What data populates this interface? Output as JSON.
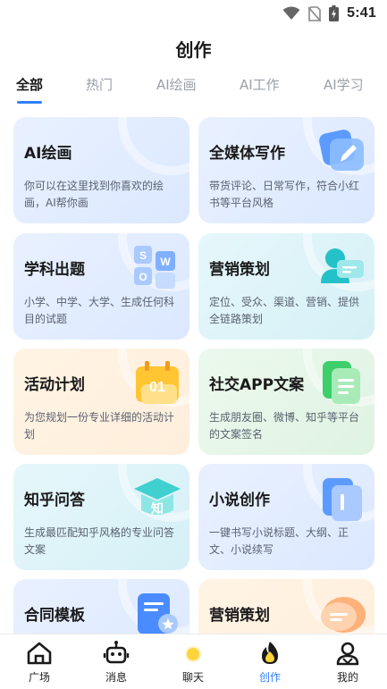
{
  "status_bar": {
    "time": "5:41"
  },
  "header": {
    "title": "创作"
  },
  "tabs": [
    {
      "label": "全部",
      "active": true
    },
    {
      "label": "热门",
      "active": false
    },
    {
      "label": "AI绘画",
      "active": false
    },
    {
      "label": "AI工作",
      "active": false
    },
    {
      "label": "AI学习",
      "active": false
    }
  ],
  "cards": [
    {
      "title": "AI绘画",
      "desc": "你可以在这里找到你喜欢的绘画，AI帮你画",
      "icon": "paint-icon"
    },
    {
      "title": "全媒体写作",
      "desc": "带货评论、日常写作，符合小红书等平台风格",
      "icon": "pencil-edit-icon"
    },
    {
      "title": "学科出题",
      "desc": "小学、中学、大学、生成任何科目的试题",
      "icon": "letter-blocks-icon",
      "icon_letters": [
        "S",
        "W",
        "O"
      ]
    },
    {
      "title": "营销策划",
      "desc": "定位、受众、渠道、营销、提供全链路策划",
      "icon": "person-chat-icon"
    },
    {
      "title": "活动计划",
      "desc": "为您规划一份专业详细的活动计划",
      "icon": "calendar-icon",
      "icon_text": "01"
    },
    {
      "title": "社交APP文案",
      "desc": "生成朋友圈、微博、知乎等平台的文案签名",
      "icon": "document-icon"
    },
    {
      "title": "知乎问答",
      "desc": "生成最匹配知乎风格的专业问答文案",
      "icon": "graduation-cap-icon",
      "icon_text": "知"
    },
    {
      "title": "小说创作",
      "desc": "一键书写小说标题、大纲、正文、小说续写",
      "icon": "book-icon"
    },
    {
      "title": "合同模板",
      "desc": "",
      "icon": "contract-icon"
    },
    {
      "title": "营销策划",
      "desc": "",
      "icon": "speech-bubble-icon"
    }
  ],
  "bottom_nav": [
    {
      "label": "广场",
      "icon": "home-icon",
      "active": false
    },
    {
      "label": "消息",
      "icon": "robot-icon",
      "active": false
    },
    {
      "label": "聊天",
      "icon": "sun-dot-icon",
      "active": false
    },
    {
      "label": "创作",
      "icon": "flame-icon",
      "active": true
    },
    {
      "label": "我的",
      "icon": "user-icon",
      "active": false
    }
  ],
  "colors": {
    "accent": "#2f80ff",
    "tab_inactive": "#9aa0a8"
  }
}
